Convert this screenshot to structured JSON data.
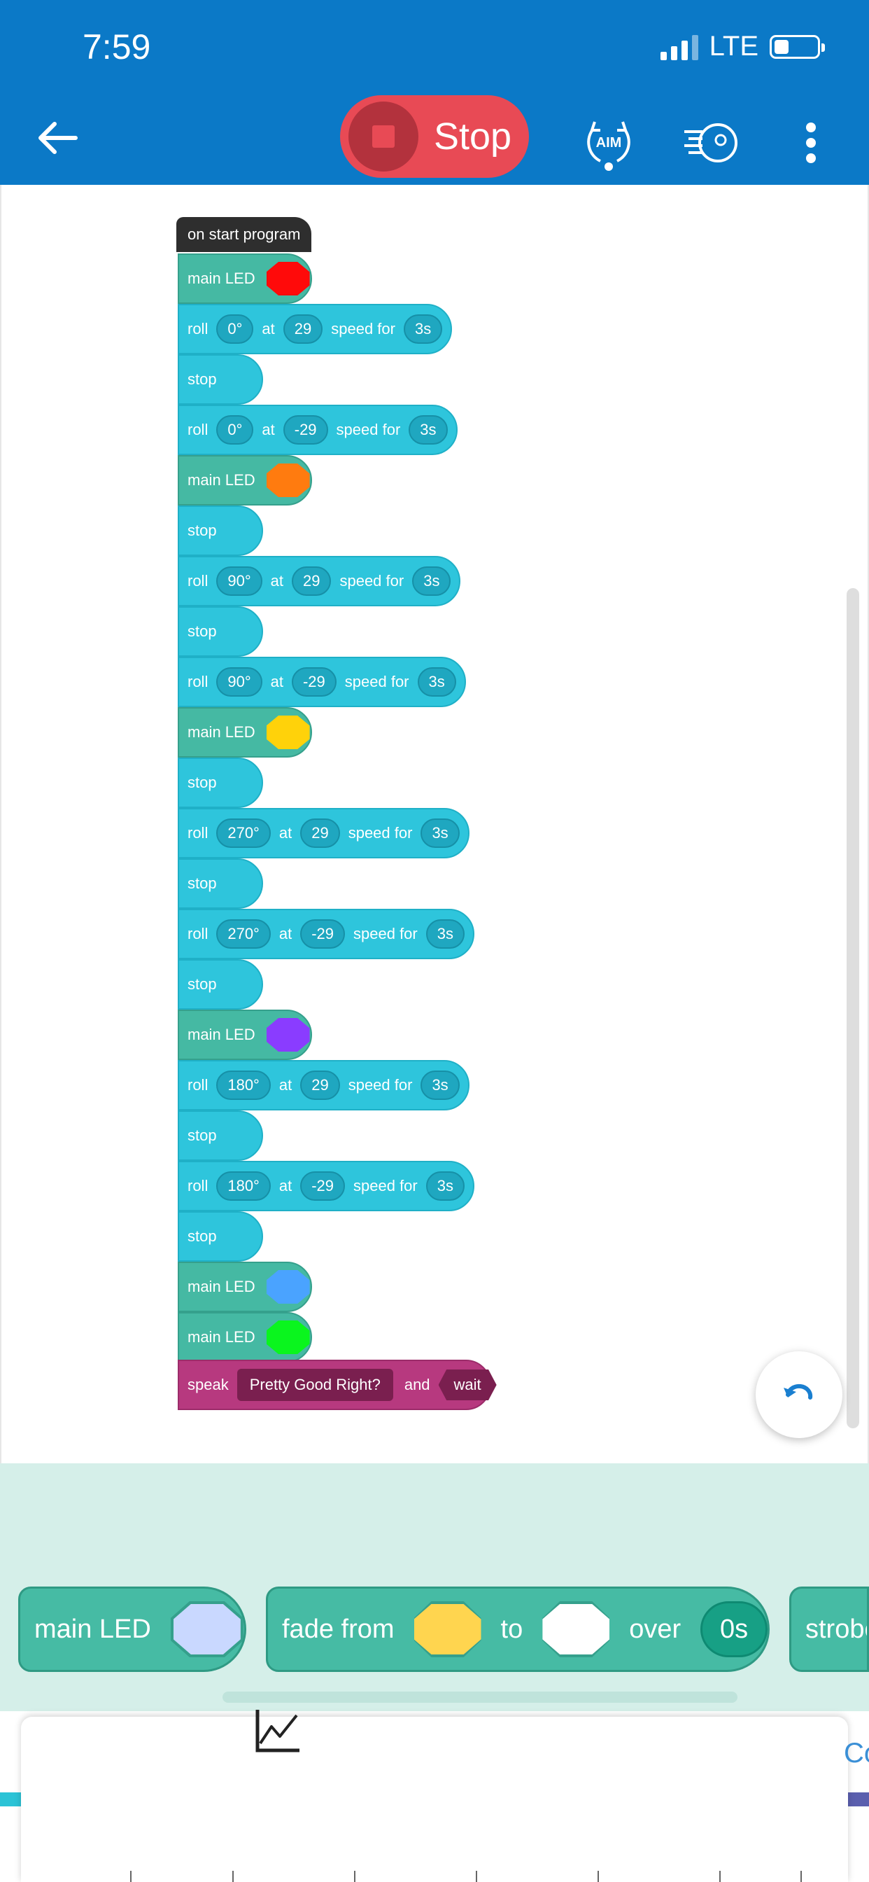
{
  "status_bar": {
    "time": "7:59",
    "network": "LTE"
  },
  "toolbar": {
    "back_icon": "arrow-left-icon",
    "stop_label": "Stop",
    "aim_label": "AIM",
    "drive_icon": "drive-icon",
    "more_icon": "more-vertical-icon"
  },
  "program": {
    "start_label": "on start program",
    "blocks": [
      {
        "type": "led",
        "label": "main LED",
        "color": "#ff0a0a"
      },
      {
        "type": "roll",
        "label": "roll",
        "heading": "0°",
        "at": "at",
        "speed": "29",
        "speed_for": "speed for",
        "duration": "3s"
      },
      {
        "type": "stop",
        "label": "stop"
      },
      {
        "type": "roll",
        "label": "roll",
        "heading": "0°",
        "at": "at",
        "speed": "-29",
        "speed_for": "speed for",
        "duration": "3s"
      },
      {
        "type": "led",
        "label": "main LED",
        "color": "#ff7b0f"
      },
      {
        "type": "stop",
        "label": "stop"
      },
      {
        "type": "roll",
        "label": "roll",
        "heading": "90°",
        "at": "at",
        "speed": "29",
        "speed_for": "speed for",
        "duration": "3s"
      },
      {
        "type": "stop",
        "label": "stop"
      },
      {
        "type": "roll",
        "label": "roll",
        "heading": "90°",
        "at": "at",
        "speed": "-29",
        "speed_for": "speed for",
        "duration": "3s"
      },
      {
        "type": "led",
        "label": "main LED",
        "color": "#ffd20a"
      },
      {
        "type": "stop",
        "label": "stop"
      },
      {
        "type": "roll",
        "label": "roll",
        "heading": "270°",
        "at": "at",
        "speed": "29",
        "speed_for": "speed for",
        "duration": "3s"
      },
      {
        "type": "stop",
        "label": "stop"
      },
      {
        "type": "roll",
        "label": "roll",
        "heading": "270°",
        "at": "at",
        "speed": "-29",
        "speed_for": "speed for",
        "duration": "3s"
      },
      {
        "type": "stop",
        "label": "stop"
      },
      {
        "type": "led",
        "label": "main LED",
        "color": "#8a3cff"
      },
      {
        "type": "roll",
        "label": "roll",
        "heading": "180°",
        "at": "at",
        "speed": "29",
        "speed_for": "speed for",
        "duration": "3s"
      },
      {
        "type": "stop",
        "label": "stop"
      },
      {
        "type": "roll",
        "label": "roll",
        "heading": "180°",
        "at": "at",
        "speed": "-29",
        "speed_for": "speed for",
        "duration": "3s"
      },
      {
        "type": "stop",
        "label": "stop"
      },
      {
        "type": "led",
        "label": "main LED",
        "color": "#4aa3ff"
      },
      {
        "type": "led",
        "label": "main LED",
        "color": "#0af51e"
      }
    ],
    "speak_block": {
      "label": "speak",
      "text": "Pretty Good Right?",
      "and": "and",
      "wait": "wait"
    }
  },
  "undo_icon": "undo-icon",
  "palette": {
    "main_led": {
      "label": "main LED",
      "color": "#c9d8ff"
    },
    "fade": {
      "from": "fade from",
      "from_color": "#ffd54f",
      "to": "to",
      "to_color": "#ffffff",
      "over": "over",
      "time": "0s"
    },
    "strobe_partial": "strobe"
  },
  "bottom_sheet": {
    "icon": "line-chart-icon",
    "tab_peek": "Co"
  }
}
